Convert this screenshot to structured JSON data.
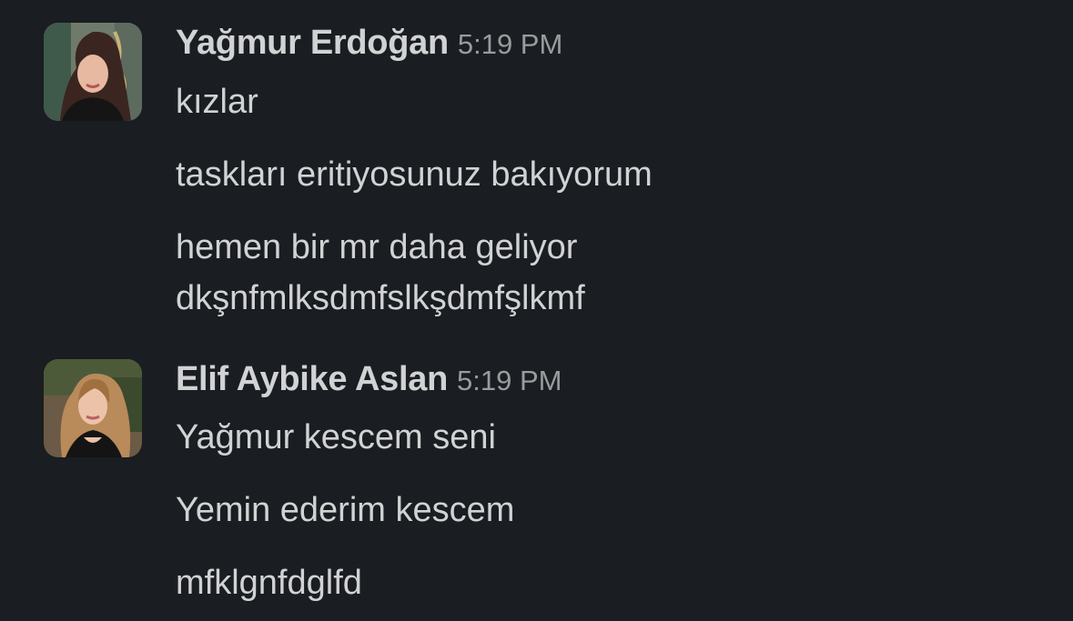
{
  "messages": [
    {
      "author": "Yağmur Erdoğan",
      "time": "5:19 PM",
      "lines": [
        "kızlar",
        "taskları eritiyosunuz bakıyorum",
        "hemen bir mr daha geliyor",
        "dkşnfmlksdmfslkşdmfşlkmf"
      ]
    },
    {
      "author": "Elif Aybike Aslan",
      "time": "5:19 PM",
      "lines": [
        "Yağmur kescem seni",
        "Yemin ederim kescem",
        "mfklgnfdglfd"
      ]
    }
  ],
  "colors": {
    "background": "#1a1d21",
    "text": "#d1d2d3",
    "timestamp": "#9a9b9d"
  }
}
